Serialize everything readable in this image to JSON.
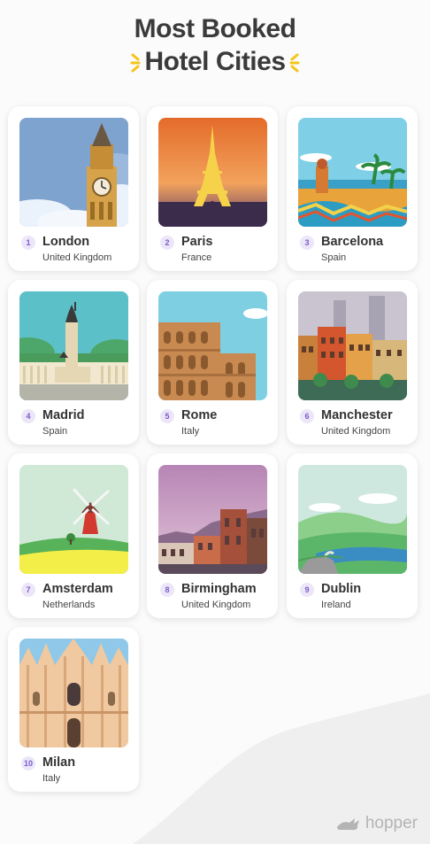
{
  "title": {
    "line1": "Most Booked",
    "line2": "Hotel Cities"
  },
  "accent_color": "#f5c518",
  "cities": [
    {
      "rank": "1",
      "name": "London",
      "country": "United Kingdom"
    },
    {
      "rank": "2",
      "name": "Paris",
      "country": "France"
    },
    {
      "rank": "3",
      "name": "Barcelona",
      "country": "Spain"
    },
    {
      "rank": "4",
      "name": "Madrid",
      "country": "Spain"
    },
    {
      "rank": "5",
      "name": "Rome",
      "country": "Italy"
    },
    {
      "rank": "6",
      "name": "Manchester",
      "country": "United Kingdom"
    },
    {
      "rank": "7",
      "name": "Amsterdam",
      "country": "Netherlands"
    },
    {
      "rank": "8",
      "name": "Birmingham",
      "country": "United Kingdom"
    },
    {
      "rank": "9",
      "name": "Dublin",
      "country": "Ireland"
    },
    {
      "rank": "10",
      "name": "Milan",
      "country": "Italy"
    }
  ],
  "brand": {
    "name": "hopper",
    "icon": "bunny-icon"
  }
}
